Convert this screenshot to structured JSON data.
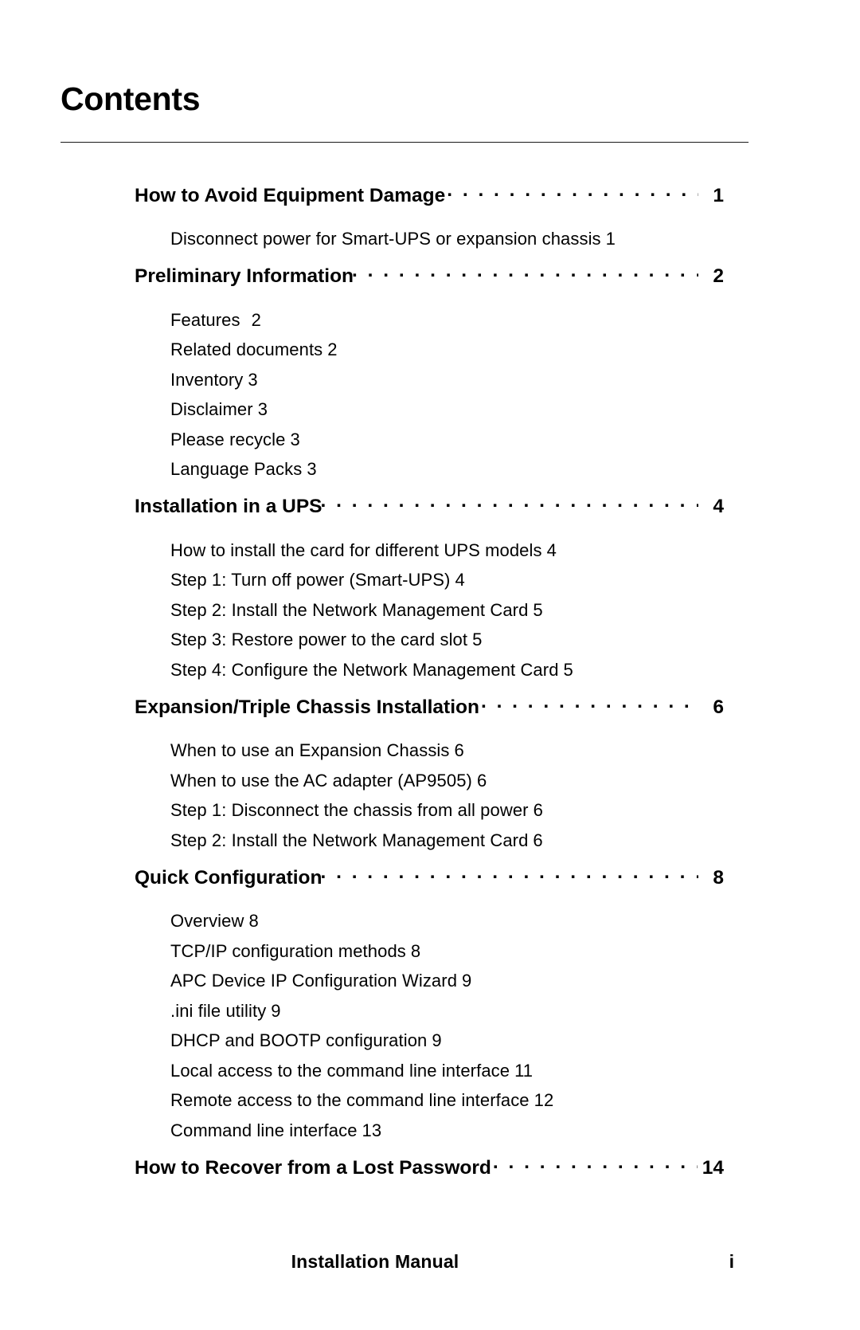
{
  "page": {
    "title": "Contents",
    "footer": {
      "document_title": "Installation Manual",
      "page_number": "i"
    }
  },
  "toc": {
    "sections": [
      {
        "label": "How to Avoid Equipment Damage",
        "page": "1",
        "items": [
          {
            "label": "Disconnect power for Smart-UPS or expansion chassis",
            "page": "1"
          }
        ]
      },
      {
        "label": "Preliminary Information",
        "page": "2",
        "items": [
          {
            "label": "Features",
            "page": "2"
          },
          {
            "label": "Related documents",
            "page": "2"
          },
          {
            "label": "Inventory",
            "page": "3"
          },
          {
            "label": "Disclaimer",
            "page": "3"
          },
          {
            "label": "Please recycle",
            "page": "3"
          },
          {
            "label": "Language Packs",
            "page": "3"
          }
        ]
      },
      {
        "label": "Installation in a UPS",
        "page": "4",
        "items": [
          {
            "label": "How to install the card for different UPS models",
            "page": "4"
          },
          {
            "label": "Step 1: Turn off power (Smart-UPS)",
            "page": "4"
          },
          {
            "label": "Step 2: Install the Network Management Card",
            "page": "5"
          },
          {
            "label": "Step 3: Restore power to the card slot",
            "page": "5"
          },
          {
            "label": "Step 4: Configure the Network Management Card",
            "page": "5"
          }
        ]
      },
      {
        "label": "Expansion/Triple Chassis Installation",
        "page": "6",
        "items": [
          {
            "label": "When to use an Expansion Chassis",
            "page": "6"
          },
          {
            "label": "When to use the AC adapter (AP9505)",
            "page": "6"
          },
          {
            "label": "Step 1: Disconnect the chassis from all power",
            "page": "6"
          },
          {
            "label": "Step 2: Install the Network Management Card",
            "page": "6"
          }
        ]
      },
      {
        "label": "Quick Configuration",
        "page": "8",
        "items": [
          {
            "label": "Overview",
            "page": "8"
          },
          {
            "label": "TCP/IP configuration methods",
            "page": "8"
          },
          {
            "label": "APC Device IP Configuration Wizard",
            "page": "9"
          },
          {
            "label": ".ini file utility",
            "page": "9"
          },
          {
            "label": "DHCP and BOOTP configuration",
            "page": "9"
          },
          {
            "label": "Local access to the command line interface",
            "page": "11"
          },
          {
            "label": "Remote access to the command line interface",
            "page": "12"
          },
          {
            "label": "Command line interface",
            "page": "13"
          }
        ]
      },
      {
        "label": "How to Recover from a Lost Password",
        "page": "14",
        "items": []
      }
    ]
  }
}
